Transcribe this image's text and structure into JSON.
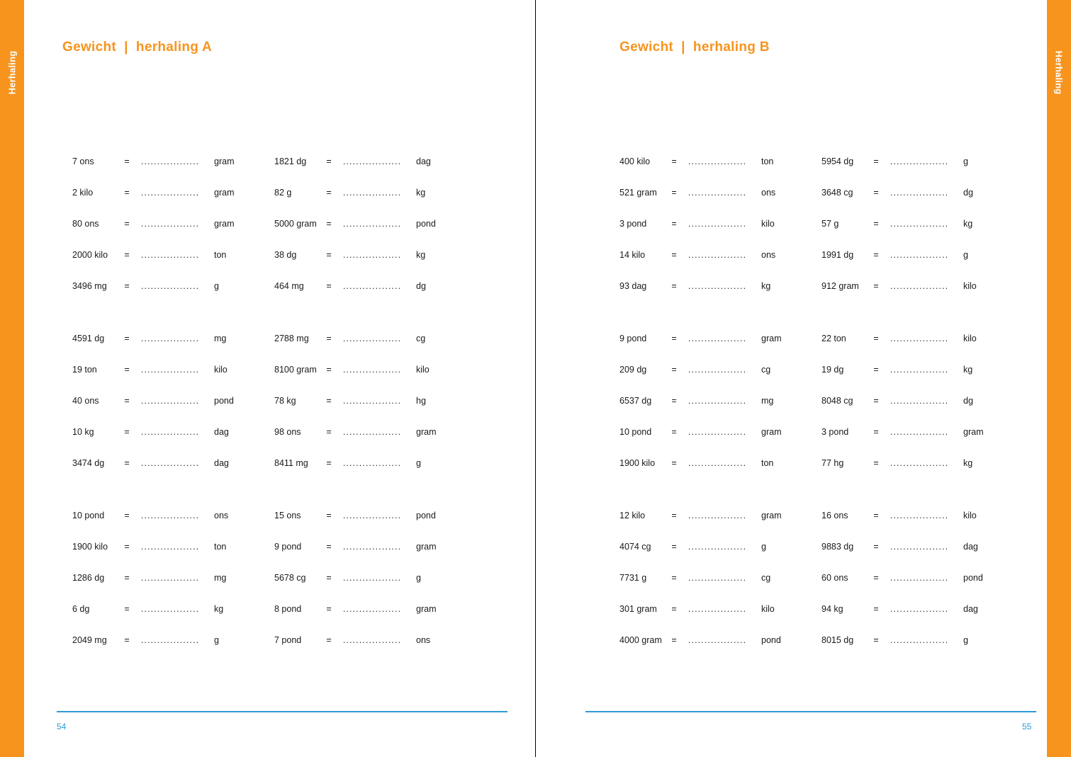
{
  "tabs": {
    "left_label": "Herhaling",
    "right_label": "Herhaling"
  },
  "colors": {
    "accent_orange": "#F7941E",
    "accent_orange_light": "#F79049",
    "page_number_blue": "#2E9BD6",
    "text": "#1a1a1a"
  },
  "pages": [
    {
      "title": "Gewicht  |  herhaling A",
      "page_number": "54",
      "columns": [
        {
          "groups": [
            {
              "rows": [
                {
                  "from": "7 ons",
                  "eq": "=",
                  "blank": "..................",
                  "to": "gram"
                },
                {
                  "from": "2 kilo",
                  "eq": "=",
                  "blank": "..................",
                  "to": "gram"
                },
                {
                  "from": "80 ons",
                  "eq": "=",
                  "blank": "..................",
                  "to": "gram"
                },
                {
                  "from": "2000 kilo",
                  "eq": "=",
                  "blank": "..................",
                  "to": "ton"
                },
                {
                  "from": "3496 mg",
                  "eq": "=",
                  "blank": "..................",
                  "to": "g"
                }
              ]
            },
            {
              "rows": [
                {
                  "from": "4591 dg",
                  "eq": "=",
                  "blank": "..................",
                  "to": "mg"
                },
                {
                  "from": "19 ton",
                  "eq": "=",
                  "blank": "..................",
                  "to": "kilo"
                },
                {
                  "from": "40 ons",
                  "eq": "=",
                  "blank": "..................",
                  "to": "pond"
                },
                {
                  "from": "10 kg",
                  "eq": "=",
                  "blank": "..................",
                  "to": "dag"
                },
                {
                  "from": "3474 dg",
                  "eq": "=",
                  "blank": "..................",
                  "to": "dag"
                }
              ]
            },
            {
              "rows": [
                {
                  "from": "10 pond",
                  "eq": "=",
                  "blank": "..................",
                  "to": "ons"
                },
                {
                  "from": "1900 kilo",
                  "eq": "=",
                  "blank": "..................",
                  "to": "ton"
                },
                {
                  "from": "1286 dg",
                  "eq": "=",
                  "blank": "..................",
                  "to": "mg"
                },
                {
                  "from": "6 dg",
                  "eq": "=",
                  "blank": "..................",
                  "to": "kg"
                },
                {
                  "from": "2049 mg",
                  "eq": "=",
                  "blank": "..................",
                  "to": "g"
                }
              ]
            }
          ]
        },
        {
          "groups": [
            {
              "rows": [
                {
                  "from": "1821 dg",
                  "eq": "=",
                  "blank": "..................",
                  "to": "dag"
                },
                {
                  "from": "82 g",
                  "eq": "=",
                  "blank": "..................",
                  "to": "kg"
                },
                {
                  "from": "5000 gram",
                  "eq": "=",
                  "blank": "..................",
                  "to": "pond"
                },
                {
                  "from": "38 dg",
                  "eq": "=",
                  "blank": "..................",
                  "to": "kg"
                },
                {
                  "from": "464 mg",
                  "eq": "=",
                  "blank": "..................",
                  "to": "dg"
                }
              ]
            },
            {
              "rows": [
                {
                  "from": "2788 mg",
                  "eq": "=",
                  "blank": "..................",
                  "to": "cg"
                },
                {
                  "from": "8100 gram",
                  "eq": "=",
                  "blank": "..................",
                  "to": "kilo"
                },
                {
                  "from": "78 kg",
                  "eq": "=",
                  "blank": "..................",
                  "to": "hg"
                },
                {
                  "from": "98 ons",
                  "eq": "=",
                  "blank": "..................",
                  "to": "gram"
                },
                {
                  "from": "8411 mg",
                  "eq": "=",
                  "blank": "..................",
                  "to": "g"
                }
              ]
            },
            {
              "rows": [
                {
                  "from": "15 ons",
                  "eq": "=",
                  "blank": "..................",
                  "to": "pond"
                },
                {
                  "from": "9 pond",
                  "eq": "=",
                  "blank": "..................",
                  "to": "gram"
                },
                {
                  "from": "5678 cg",
                  "eq": "=",
                  "blank": "..................",
                  "to": "g"
                },
                {
                  "from": "8 pond",
                  "eq": "=",
                  "blank": "..................",
                  "to": "gram"
                },
                {
                  "from": "7 pond",
                  "eq": "=",
                  "blank": "..................",
                  "to": "ons"
                }
              ]
            }
          ]
        }
      ]
    },
    {
      "title": "Gewicht  |  herhaling B",
      "page_number": "55",
      "columns": [
        {
          "groups": [
            {
              "rows": [
                {
                  "from": "400 kilo",
                  "eq": "=",
                  "blank": "..................",
                  "to": "ton"
                },
                {
                  "from": "521 gram",
                  "eq": "=",
                  "blank": "..................",
                  "to": "ons"
                },
                {
                  "from": "3 pond",
                  "eq": "=",
                  "blank": "..................",
                  "to": "kilo"
                },
                {
                  "from": "14 kilo",
                  "eq": "=",
                  "blank": "..................",
                  "to": "ons"
                },
                {
                  "from": "93 dag",
                  "eq": "=",
                  "blank": "..................",
                  "to": "kg"
                }
              ]
            },
            {
              "rows": [
                {
                  "from": "9 pond",
                  "eq": "=",
                  "blank": "..................",
                  "to": "gram"
                },
                {
                  "from": "209 dg",
                  "eq": "=",
                  "blank": "..................",
                  "to": "cg"
                },
                {
                  "from": "6537 dg",
                  "eq": "=",
                  "blank": "..................",
                  "to": "mg"
                },
                {
                  "from": "10 pond",
                  "eq": "=",
                  "blank": "..................",
                  "to": "gram"
                },
                {
                  "from": "1900 kilo",
                  "eq": "=",
                  "blank": "..................",
                  "to": "ton"
                }
              ]
            },
            {
              "rows": [
                {
                  "from": "12 kilo",
                  "eq": "=",
                  "blank": "..................",
                  "to": "gram"
                },
                {
                  "from": "4074 cg",
                  "eq": "=",
                  "blank": "..................",
                  "to": "g"
                },
                {
                  "from": "7731 g",
                  "eq": "=",
                  "blank": "..................",
                  "to": "cg"
                },
                {
                  "from": "301 gram",
                  "eq": "=",
                  "blank": "..................",
                  "to": "kilo"
                },
                {
                  "from": "4000 gram",
                  "eq": "=",
                  "blank": "..................",
                  "to": "pond"
                }
              ]
            }
          ]
        },
        {
          "groups": [
            {
              "rows": [
                {
                  "from": "5954 dg",
                  "eq": "=",
                  "blank": "..................",
                  "to": "g"
                },
                {
                  "from": "3648 cg",
                  "eq": "=",
                  "blank": "..................",
                  "to": "dg"
                },
                {
                  "from": "57 g",
                  "eq": "=",
                  "blank": "..................",
                  "to": "kg"
                },
                {
                  "from": "1991 dg",
                  "eq": "=",
                  "blank": "..................",
                  "to": "g"
                },
                {
                  "from": "912 gram",
                  "eq": "=",
                  "blank": "..................",
                  "to": "kilo"
                }
              ]
            },
            {
              "rows": [
                {
                  "from": "22 ton",
                  "eq": "=",
                  "blank": "..................",
                  "to": "kilo"
                },
                {
                  "from": "19 dg",
                  "eq": "=",
                  "blank": "..................",
                  "to": "kg"
                },
                {
                  "from": "8048 cg",
                  "eq": "=",
                  "blank": "..................",
                  "to": "dg"
                },
                {
                  "from": "3 pond",
                  "eq": "=",
                  "blank": "..................",
                  "to": "gram"
                },
                {
                  "from": "77 hg",
                  "eq": "=",
                  "blank": "..................",
                  "to": "kg"
                }
              ]
            },
            {
              "rows": [
                {
                  "from": "16 ons",
                  "eq": "=",
                  "blank": "..................",
                  "to": "kilo"
                },
                {
                  "from": "9883 dg",
                  "eq": "=",
                  "blank": "..................",
                  "to": "dag"
                },
                {
                  "from": "60 ons",
                  "eq": "=",
                  "blank": "..................",
                  "to": "pond"
                },
                {
                  "from": "94 kg",
                  "eq": "=",
                  "blank": "..................",
                  "to": "dag"
                },
                {
                  "from": "8015 dg",
                  "eq": "=",
                  "blank": "..................",
                  "to": "g"
                }
              ]
            }
          ]
        }
      ]
    }
  ]
}
